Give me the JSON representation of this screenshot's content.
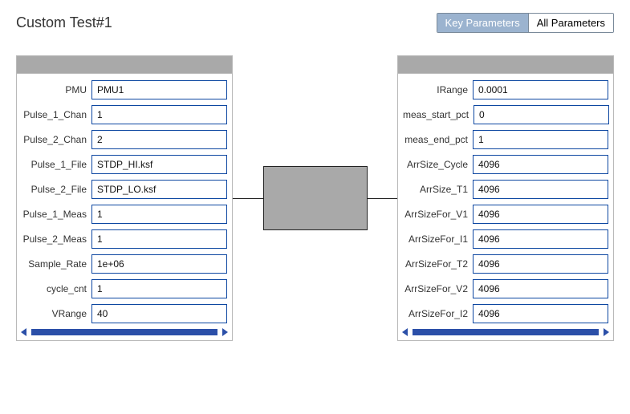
{
  "title": "Custom Test#1",
  "tabs": {
    "key": "Key Parameters",
    "all": "All Parameters",
    "active": "key"
  },
  "left_params": [
    {
      "label": "PMU",
      "value": "PMU1"
    },
    {
      "label": "Pulse_1_Chan",
      "value": "1"
    },
    {
      "label": "Pulse_2_Chan",
      "value": "2"
    },
    {
      "label": "Pulse_1_File",
      "value": "STDP_HI.ksf"
    },
    {
      "label": "Pulse_2_File",
      "value": "STDP_LO.ksf"
    },
    {
      "label": "Pulse_1_Meas",
      "value": "1"
    },
    {
      "label": "Pulse_2_Meas",
      "value": "1"
    },
    {
      "label": "Sample_Rate",
      "value": "1e+06"
    },
    {
      "label": "cycle_cnt",
      "value": "1"
    },
    {
      "label": "VRange",
      "value": "40"
    }
  ],
  "right_params": [
    {
      "label": "IRange",
      "value": "0.0001"
    },
    {
      "label": "meas_start_pct",
      "value": "0"
    },
    {
      "label": "meas_end_pct",
      "value": "1"
    },
    {
      "label": "ArrSize_Cycle",
      "value": "4096"
    },
    {
      "label": "ArrSize_T1",
      "value": "4096"
    },
    {
      "label": "ArrSizeFor_V1",
      "value": "4096"
    },
    {
      "label": "ArrSizeFor_I1",
      "value": "4096"
    },
    {
      "label": "ArrSizeFor_T2",
      "value": "4096"
    },
    {
      "label": "ArrSizeFor_V2",
      "value": "4096"
    },
    {
      "label": "ArrSizeFor_I2",
      "value": "4096"
    }
  ]
}
